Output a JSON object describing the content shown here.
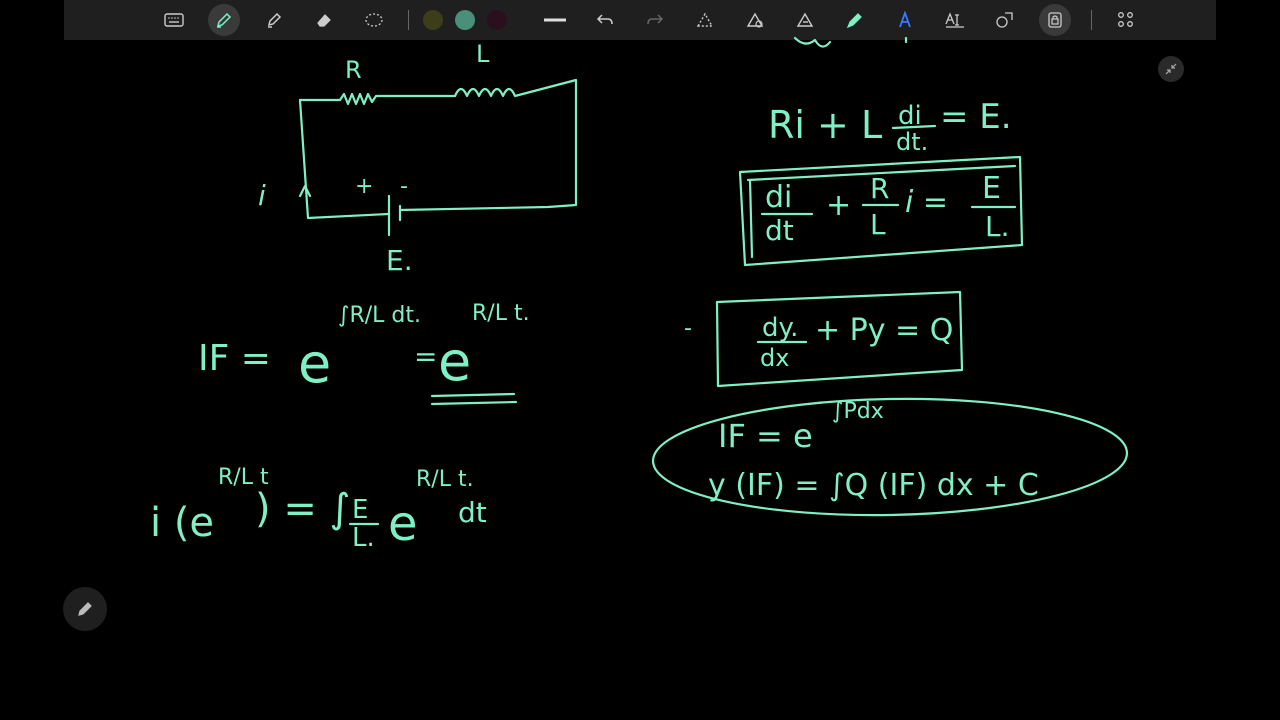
{
  "toolbar": {
    "tools": [
      {
        "name": "keyboard-icon"
      },
      {
        "name": "pen-icon"
      },
      {
        "name": "highlighter-icon"
      },
      {
        "name": "eraser-icon"
      },
      {
        "name": "lasso-icon"
      }
    ],
    "swatches": [
      "#3d3d1a",
      "#4a8f7a",
      "#2a0f1f"
    ],
    "actions": [
      {
        "name": "line-weight-icon"
      },
      {
        "name": "undo-icon"
      },
      {
        "name": "redo-icon"
      },
      {
        "name": "ink-to-shape-icon"
      },
      {
        "name": "ink-to-math-icon"
      },
      {
        "name": "ink-replay-icon"
      },
      {
        "name": "ruler-pen-icon"
      },
      {
        "name": "ink-to-text-icon"
      },
      {
        "name": "text-tool-icon"
      },
      {
        "name": "shapes-icon"
      },
      {
        "name": "lock-icon"
      }
    ],
    "grid": {
      "name": "apps-grid-icon"
    }
  },
  "ink_color": "#7ff0c4",
  "board": {
    "circuit": {
      "r": "R",
      "l": "L",
      "i": "i",
      "plus1": "+",
      "minus": "-",
      "e": "E."
    },
    "eq1": {
      "lhs": "Ri + L",
      "frac_num": "di",
      "frac_den": "dt.",
      "rhs": "= E."
    },
    "eq2": {
      "n1": "di",
      "d1": "dt",
      "plus": "+",
      "n2": "R",
      "d2": "L",
      "i": "i =",
      "n3": "E",
      "d3": "L."
    },
    "if_eq": {
      "lhs": "IF =",
      "e1": "e",
      "exp1": "∫R/L dt.",
      "eq": "=",
      "e2": "e",
      "exp2": "R/L t."
    },
    "std_form": {
      "dash": "-",
      "n": "dy.",
      "d": "dx",
      "rest": "+ Py = Q"
    },
    "if_general": {
      "line1": "IF = e",
      "exp": "∫Pdx",
      "line2": "y (IF) = ∫Q (IF) dx + C"
    },
    "solution": {
      "lhs": "i (e",
      "exp1": "R/L t",
      "rhs": ") = ∫",
      "n": "E",
      "d": "L.",
      "e2": "e",
      "exp2": "R/L t.",
      "dt": "dt"
    }
  }
}
